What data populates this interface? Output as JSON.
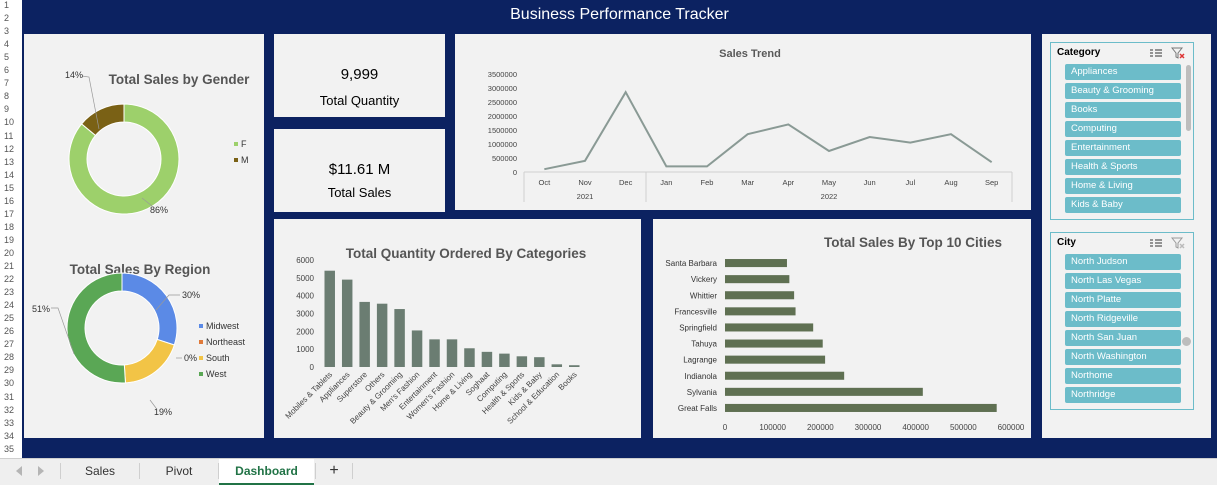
{
  "dashboard_title": "Business Performance Tracker",
  "row_numbers": [
    "1",
    "2",
    "3",
    "4",
    "5",
    "6",
    "7",
    "8",
    "9",
    "10",
    "11",
    "12",
    "13",
    "14",
    "15",
    "16",
    "17",
    "18",
    "19",
    "20",
    "21",
    "22",
    "23",
    "24",
    "25",
    "26",
    "27",
    "28",
    "29",
    "30",
    "31",
    "32",
    "33",
    "34",
    "35"
  ],
  "kpis": {
    "quantity_value": "9,999",
    "quantity_label": "Total Quantity",
    "sales_value": "$11.61 M",
    "sales_label": "Total Sales"
  },
  "chart_data": [
    {
      "type": "pie",
      "title": "Total Sales by Gender",
      "labels": [
        "F",
        "M"
      ],
      "values": [
        86,
        14
      ],
      "data_labels": [
        "86%",
        "14%"
      ],
      "colors": [
        "#9dd06b",
        "#7a6115"
      ],
      "legend": "right"
    },
    {
      "type": "pie",
      "title": "Total Sales By Region",
      "labels": [
        "Midwest",
        "Northeast",
        "South",
        "West"
      ],
      "values": [
        30,
        0,
        19,
        51
      ],
      "data_labels": [
        "30%",
        "0%",
        "19%",
        "51%"
      ],
      "colors": [
        "#5b8ae6",
        "#e07a3a",
        "#f2c446",
        "#5aa755"
      ],
      "legend": "right"
    },
    {
      "type": "line",
      "title": "Sales Trend",
      "categories": [
        "Oct",
        "Nov",
        "Dec",
        "Jan",
        "Feb",
        "Mar",
        "Apr",
        "May",
        "Jun",
        "Jul",
        "Aug",
        "Sep"
      ],
      "year_groups": [
        {
          "label": "2021",
          "span": 3
        },
        {
          "label": "2022",
          "span": 9
        }
      ],
      "values": [
        100000,
        400000,
        2850000,
        200000,
        200000,
        1350000,
        1700000,
        750000,
        1250000,
        1050000,
        1350000,
        350000
      ],
      "ylim": [
        0,
        3500000
      ],
      "yticks": [
        "0",
        "500000",
        "1000000",
        "1500000",
        "2000000",
        "2500000",
        "3000000",
        "3500000"
      ],
      "color": "#8a9a95"
    },
    {
      "type": "bar",
      "title": "Total Quantity Ordered By Categories",
      "categories": [
        "Mobiles & Tablets",
        "Appliances",
        "Superstore",
        "Others",
        "Beauty & Grooming",
        "Men's Fashion",
        "Entertainment",
        "Women's Fashion",
        "Home & Living",
        "Soghaat",
        "Computing",
        "Health & Sports",
        "Kids & Baby",
        "School & Education",
        "Books"
      ],
      "values": [
        5400,
        4900,
        3650,
        3550,
        3250,
        2050,
        1550,
        1550,
        1050,
        850,
        750,
        600,
        550,
        150,
        100
      ],
      "ylim": [
        0,
        6000
      ],
      "yticks": [
        "0",
        "1000",
        "2000",
        "3000",
        "4000",
        "5000",
        "6000"
      ],
      "color": "#6b7d72"
    },
    {
      "type": "bar",
      "orientation": "horizontal",
      "title": "Total Sales By Top 10 Cities",
      "categories": [
        "Santa Barbara",
        "Vickery",
        "Whittier",
        "Francesville",
        "Springfield",
        "Tahuya",
        "Lagrange",
        "Indianola",
        "Sylvania",
        "Great Falls"
      ],
      "values": [
        130000,
        135000,
        145000,
        148000,
        185000,
        205000,
        210000,
        250000,
        415000,
        570000
      ],
      "xlim": [
        0,
        600000
      ],
      "xticks": [
        "0",
        "100000",
        "200000",
        "300000",
        "400000",
        "500000",
        "600000"
      ],
      "color": "#5f7052"
    }
  ],
  "slicers": {
    "category": {
      "title": "Category",
      "items": [
        "Appliances",
        "Beauty & Grooming",
        "Books",
        "Computing",
        "Entertainment",
        "Health & Sports",
        "Home & Living",
        "Kids & Baby"
      ]
    },
    "city": {
      "title": "City",
      "items": [
        "North Judson",
        "North Las Vegas",
        "North Platte",
        "North Ridgeville",
        "North San Juan",
        "North Washington",
        "Northome",
        "Northridge"
      ]
    }
  },
  "sheet_tabs": {
    "tab1": "Sales",
    "tab2": "Pivot",
    "tab3": "Dashboard",
    "add": "+"
  }
}
